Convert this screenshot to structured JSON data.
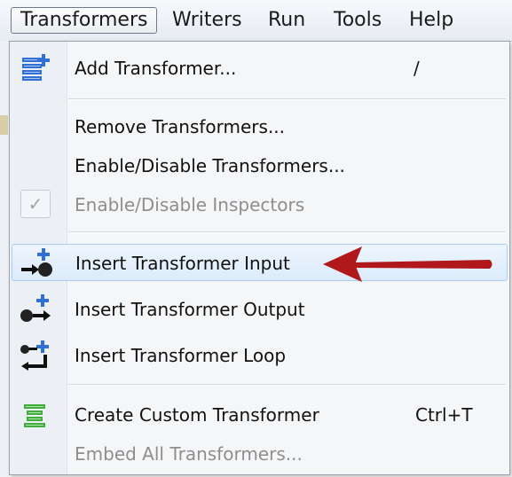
{
  "menubar": {
    "items": [
      {
        "label": "Transformers"
      },
      {
        "label": "Writers"
      },
      {
        "label": "Run"
      },
      {
        "label": "Tools"
      },
      {
        "label": "Help"
      }
    ]
  },
  "menu": {
    "items": [
      {
        "label": "Add Transformer...",
        "shortcut": "/",
        "icon": "add-transformer-icon"
      },
      {
        "label": "Remove Transformers..."
      },
      {
        "label": "Enable/Disable Transformers..."
      },
      {
        "label": "Enable/Disable Inspectors",
        "icon": "checkmark-icon",
        "disabled": true
      },
      {
        "label": "Insert Transformer Input",
        "icon": "insert-input-icon",
        "highlighted": true
      },
      {
        "label": "Insert Transformer Output",
        "icon": "insert-output-icon"
      },
      {
        "label": "Insert Transformer Loop",
        "icon": "insert-loop-icon"
      },
      {
        "label": "Create Custom Transformer",
        "shortcut": "Ctrl+T",
        "icon": "custom-transformer-icon"
      },
      {
        "label": "Embed All Transformers...",
        "disabled": true
      }
    ]
  },
  "colors": {
    "highlight": "#dcebfb",
    "annotation_arrow": "#b0181c",
    "add_icon_blue": "#2f6fd6",
    "custom_icon_green": "#3fae3a"
  }
}
